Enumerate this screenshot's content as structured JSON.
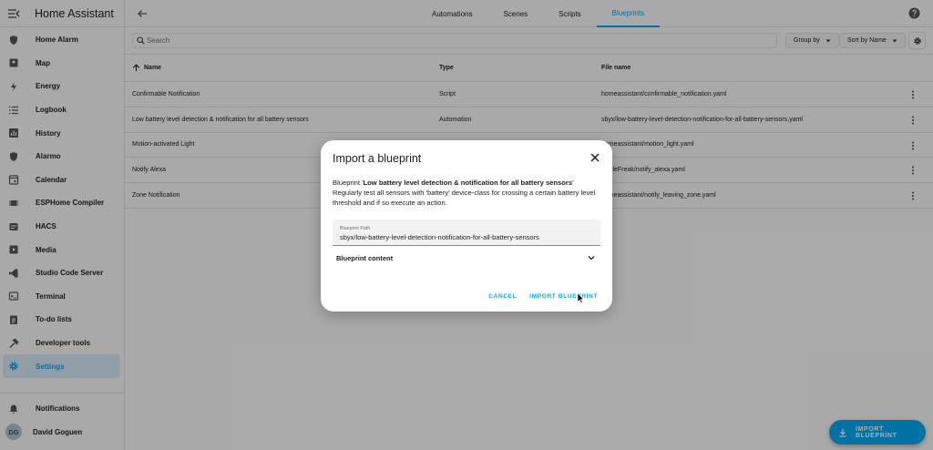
{
  "app": {
    "title": "Home Assistant"
  },
  "sidebar": {
    "items": [
      {
        "label": "Home Alarm",
        "icon": "shield-icon"
      },
      {
        "label": "Map",
        "icon": "map-icon"
      },
      {
        "label": "Energy",
        "icon": "lightning-icon"
      },
      {
        "label": "Logbook",
        "icon": "logbook-icon"
      },
      {
        "label": "History",
        "icon": "chart-icon"
      },
      {
        "label": "Alarmo",
        "icon": "shield-icon"
      },
      {
        "label": "Calendar",
        "icon": "calendar-icon"
      },
      {
        "label": "ESPHome Compiler",
        "icon": "chip-icon"
      },
      {
        "label": "HACS",
        "icon": "hacs-icon"
      },
      {
        "label": "Media",
        "icon": "media-icon"
      },
      {
        "label": "Studio Code Server",
        "icon": "code-icon"
      },
      {
        "label": "Terminal",
        "icon": "terminal-icon"
      },
      {
        "label": "To-do lists",
        "icon": "clipboard-icon"
      },
      {
        "label": "Developer tools",
        "icon": "hammer-icon"
      },
      {
        "label": "Settings",
        "icon": "gear-icon",
        "active": true
      }
    ],
    "notifications": "Notifications",
    "user": {
      "initials": "DG",
      "name": "David Goguen"
    }
  },
  "topbar": {
    "tabs": [
      {
        "label": "Automations"
      },
      {
        "label": "Scenes"
      },
      {
        "label": "Scripts"
      },
      {
        "label": "Blueprints",
        "active": true
      }
    ]
  },
  "toolbar": {
    "search_placeholder": "Search",
    "group_by": "Group by",
    "sort_by": "Sort by Name"
  },
  "table": {
    "headers": {
      "name": "Name",
      "type": "Type",
      "file": "File name"
    },
    "rows": [
      {
        "name": "Confirmable Notification",
        "type": "Script",
        "file": "homeassistant/confirmable_notification.yaml"
      },
      {
        "name": "Low battery level detection & notification for all battery sensors",
        "type": "Automation",
        "file": "sbyx/low-battery-level-detection-notification-for-all-battery-sensors.yaml"
      },
      {
        "name": "Motion-activated Light",
        "type": "",
        "file": "homeassistant/motion_light.yaml"
      },
      {
        "name": "Notify Alexa",
        "type": "",
        "file": "AppleFreak/notify_alexa.yaml"
      },
      {
        "name": "Zone Notification",
        "type": "",
        "file": "homeassistant/notify_leaving_zone.yaml"
      }
    ]
  },
  "dialog": {
    "title": "Import a blueprint",
    "desc_prefix": "Blueprint '",
    "blueprint_name": "Low battery level detection & notification for all battery sensors",
    "desc_suffix": "'",
    "description": "Regularly test all sensors with 'battery' device-class for crossing a certain battery level threshold and if so execute an action.",
    "path_label": "Blueprint Path",
    "path_value": "sbyx/low-battery-level-detection-notification-for-all-battery-sensors",
    "content_label": "Blueprint content",
    "cancel": "CANCEL",
    "import": "IMPORT BLUEPRINT"
  },
  "fab": {
    "label": "IMPORT BLUEPRINT"
  },
  "colors": {
    "accent": "#03a9f4",
    "active_bg": "#d6e7f6"
  }
}
